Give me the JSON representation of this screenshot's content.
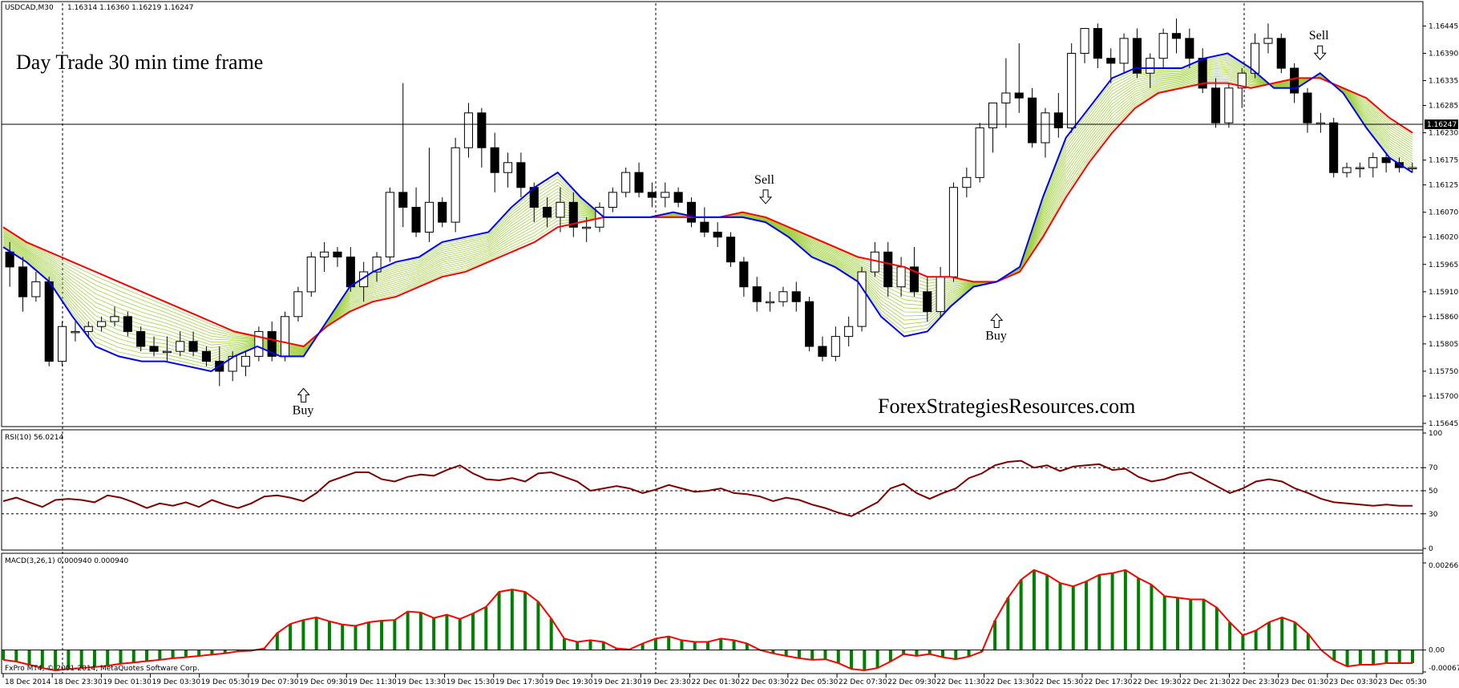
{
  "chart_data": [
    {
      "type": "candlestick",
      "title": "USDCAD,M30",
      "ohlc_readout": "1.16314 1.16360 1.16219 1.16247",
      "annotation_title": "Day Trade 30 min time frame",
      "watermark": "ForexStrategiesResources.com",
      "ylim": [
        1.15645,
        1.16465
      ],
      "yticks": [
        "1.16445",
        "1.16390",
        "1.16335",
        "1.16285",
        "1.16230",
        "1.16175",
        "1.16125",
        "1.16070",
        "1.16020",
        "1.15965",
        "1.15910",
        "1.15860",
        "1.15805",
        "1.15750",
        "1.15700",
        "1.15645"
      ],
      "current_price": "1.16247",
      "signals": [
        {
          "label": "Buy",
          "x_index": 13,
          "direction": "up"
        },
        {
          "label": "Sell",
          "x_index": 33,
          "direction": "down"
        },
        {
          "label": "Buy",
          "x_index": 43,
          "direction": "up"
        },
        {
          "label": "Sell",
          "x_index": 57,
          "direction": "down"
        }
      ],
      "x_tick_labels": [
        "18 Dec 2014",
        "18 Dec 23:30",
        "19 Dec 01:30",
        "19 Dec 03:30",
        "19 Dec 05:30",
        "19 Dec 07:30",
        "19 Dec 09:30",
        "19 Dec 11:30",
        "19 Dec 13:30",
        "19 Dec 15:30",
        "19 Dec 17:30",
        "19 Dec 19:30",
        "19 Dec 21:30",
        "19 Dec 23:30",
        "22 Dec 01:30",
        "22 Dec 03:30",
        "22 Dec 05:30",
        "22 Dec 07:30",
        "22 Dec 09:30",
        "22 Dec 11:30",
        "22 Dec 13:30",
        "22 Dec 15:30",
        "22 Dec 17:30",
        "22 Dec 19:30",
        "22 Dec 21:30",
        "22 Dec 23:30",
        "23 Dec 01:30",
        "23 Dec 03:30",
        "23 Dec 05:30"
      ],
      "fast_ema": [
        1.16,
        1.1597,
        1.1593,
        1.1586,
        1.158,
        1.1578,
        1.1577,
        1.1577,
        1.1576,
        1.1575,
        1.1578,
        1.158,
        1.1578,
        1.1578,
        1.1585,
        1.1592,
        1.1595,
        1.1597,
        1.1598,
        1.1601,
        1.1602,
        1.1603,
        1.1608,
        1.1612,
        1.1615,
        1.161,
        1.1606,
        1.1606,
        1.1606,
        1.1607,
        1.1606,
        1.1606,
        1.1606,
        1.1605,
        1.1602,
        1.1598,
        1.1596,
        1.1593,
        1.1586,
        1.1582,
        1.1583,
        1.1588,
        1.1592,
        1.1593,
        1.1596,
        1.161,
        1.1622,
        1.1628,
        1.1634,
        1.1636,
        1.1636,
        1.1636,
        1.1638,
        1.1639,
        1.1636,
        1.1632,
        1.1632,
        1.1635,
        1.1631,
        1.1624,
        1.1618,
        1.1615
      ],
      "slow_ema": [
        1.1604,
        1.1601,
        1.1599,
        1.1597,
        1.1595,
        1.1593,
        1.1591,
        1.1589,
        1.1587,
        1.1585,
        1.1583,
        1.1582,
        1.1581,
        1.158,
        1.1584,
        1.1587,
        1.1589,
        1.159,
        1.1592,
        1.1594,
        1.1595,
        1.1597,
        1.1599,
        1.1601,
        1.1604,
        1.1605,
        1.1606,
        1.1606,
        1.1606,
        1.1606,
        1.1606,
        1.1606,
        1.1607,
        1.1606,
        1.1604,
        1.1602,
        1.16,
        1.1598,
        1.1597,
        1.1596,
        1.1594,
        1.1594,
        1.1593,
        1.1593,
        1.1595,
        1.1602,
        1.161,
        1.1617,
        1.1623,
        1.1628,
        1.1631,
        1.1632,
        1.1633,
        1.1633,
        1.1632,
        1.1633,
        1.1634,
        1.1634,
        1.1632,
        1.163,
        1.1626,
        1.1623
      ],
      "candles": [
        [
          1.1599,
          1.1601,
          1.1592,
          1.1596
        ],
        [
          1.1596,
          1.1598,
          1.1587,
          1.159
        ],
        [
          1.159,
          1.1595,
          1.1589,
          1.1593
        ],
        [
          1.1593,
          1.1594,
          1.1576,
          1.1577
        ],
        [
          1.1577,
          1.1585,
          1.1576,
          1.1584
        ],
        [
          1.1583,
          1.1585,
          1.1581,
          1.1583
        ],
        [
          1.1583,
          1.1585,
          1.1582,
          1.1584
        ],
        [
          1.1584,
          1.1586,
          1.1583,
          1.1585
        ],
        [
          1.1585,
          1.1588,
          1.1584,
          1.1586
        ],
        [
          1.1586,
          1.1587,
          1.1582,
          1.1583
        ],
        [
          1.1583,
          1.1584,
          1.1579,
          1.158
        ],
        [
          1.158,
          1.1582,
          1.1578,
          1.1579
        ],
        [
          1.1579,
          1.1582,
          1.1577,
          1.1579
        ],
        [
          1.1579,
          1.1583,
          1.1578,
          1.1581
        ],
        [
          1.1581,
          1.1583,
          1.1578,
          1.1579
        ],
        [
          1.1579,
          1.158,
          1.1576,
          1.1577
        ],
        [
          1.1577,
          1.158,
          1.1572,
          1.1575
        ],
        [
          1.1575,
          1.1579,
          1.1573,
          1.1578
        ],
        [
          1.1576,
          1.1579,
          1.1574,
          1.1578
        ],
        [
          1.1578,
          1.1584,
          1.1577,
          1.1583
        ],
        [
          1.1583,
          1.1585,
          1.1577,
          1.1578
        ],
        [
          1.1578,
          1.1587,
          1.1577,
          1.1586
        ],
        [
          1.1586,
          1.1592,
          1.1585,
          1.1591
        ],
        [
          1.1591,
          1.1599,
          1.159,
          1.1598
        ],
        [
          1.1598,
          1.1601,
          1.1595,
          1.1599
        ],
        [
          1.1599,
          1.16,
          1.1596,
          1.1598
        ],
        [
          1.1598,
          1.16,
          1.1591,
          1.1592
        ],
        [
          1.1592,
          1.1597,
          1.1589,
          1.1595
        ],
        [
          1.1595,
          1.1599,
          1.1593,
          1.1598
        ],
        [
          1.1598,
          1.1612,
          1.1597,
          1.1611
        ],
        [
          1.1611,
          1.1633,
          1.1604,
          1.1608
        ],
        [
          1.1608,
          1.1612,
          1.1602,
          1.1603
        ],
        [
          1.1603,
          1.162,
          1.1601,
          1.1609
        ],
        [
          1.1609,
          1.161,
          1.1604,
          1.1605
        ],
        [
          1.1605,
          1.1622,
          1.1603,
          1.162
        ],
        [
          1.162,
          1.1629,
          1.1618,
          1.1627
        ],
        [
          1.1627,
          1.1628,
          1.1616,
          1.162
        ],
        [
          1.162,
          1.1623,
          1.1611,
          1.1615
        ],
        [
          1.1615,
          1.1619,
          1.1612,
          1.1617
        ],
        [
          1.1617,
          1.1619,
          1.161,
          1.1612
        ],
        [
          1.1612,
          1.1613,
          1.1605,
          1.1608
        ],
        [
          1.1608,
          1.161,
          1.1604,
          1.1606
        ],
        [
          1.1606,
          1.1612,
          1.1603,
          1.1609
        ],
        [
          1.1609,
          1.1611,
          1.1602,
          1.1604
        ],
        [
          1.1604,
          1.1606,
          1.1601,
          1.1604
        ],
        [
          1.1604,
          1.1609,
          1.1603,
          1.1608
        ],
        [
          1.1608,
          1.1612,
          1.1607,
          1.1611
        ],
        [
          1.1611,
          1.1616,
          1.161,
          1.1615
        ],
        [
          1.1615,
          1.1617,
          1.161,
          1.1611
        ],
        [
          1.1611,
          1.1613,
          1.1608,
          1.161
        ],
        [
          1.161,
          1.1613,
          1.1608,
          1.1611
        ],
        [
          1.1611,
          1.1612,
          1.1608,
          1.1609
        ],
        [
          1.1609,
          1.161,
          1.1604,
          1.1605
        ],
        [
          1.1605,
          1.1608,
          1.1602,
          1.1603
        ],
        [
          1.1603,
          1.1605,
          1.16,
          1.1602
        ],
        [
          1.1602,
          1.1603,
          1.1596,
          1.1597
        ],
        [
          1.1597,
          1.1598,
          1.159,
          1.1592
        ],
        [
          1.1592,
          1.1594,
          1.1587,
          1.1589
        ],
        [
          1.1589,
          1.1591,
          1.1587,
          1.1589
        ],
        [
          1.1589,
          1.1592,
          1.1588,
          1.1591
        ],
        [
          1.1591,
          1.1593,
          1.1587,
          1.1589
        ],
        [
          1.1589,
          1.159,
          1.1579,
          1.158
        ],
        [
          1.158,
          1.1582,
          1.1577,
          1.1578
        ],
        [
          1.1578,
          1.1584,
          1.1577,
          1.1582
        ],
        [
          1.1582,
          1.1586,
          1.158,
          1.1584
        ],
        [
          1.1584,
          1.1596,
          1.1583,
          1.1595
        ],
        [
          1.1595,
          1.1601,
          1.1594,
          1.1599
        ],
        [
          1.1599,
          1.1601,
          1.159,
          1.1592
        ],
        [
          1.1592,
          1.1598,
          1.159,
          1.1596
        ],
        [
          1.1596,
          1.16,
          1.159,
          1.1591
        ],
        [
          1.1591,
          1.1594,
          1.1585,
          1.1587
        ],
        [
          1.1587,
          1.1596,
          1.1586,
          1.1594
        ],
        [
          1.1594,
          1.1613,
          1.1593,
          1.1612
        ],
        [
          1.1612,
          1.1616,
          1.161,
          1.1614
        ],
        [
          1.1614,
          1.1625,
          1.1613,
          1.1624
        ],
        [
          1.1624,
          1.1629,
          1.1619,
          1.1629
        ],
        [
          1.1629,
          1.1638,
          1.1624,
          1.1631
        ],
        [
          1.1631,
          1.1641,
          1.1627,
          1.163
        ],
        [
          1.163,
          1.1632,
          1.162,
          1.1621
        ],
        [
          1.1621,
          1.1628,
          1.1618,
          1.1627
        ],
        [
          1.1627,
          1.1631,
          1.1622,
          1.1624
        ],
        [
          1.1624,
          1.1641,
          1.1623,
          1.1639
        ],
        [
          1.1639,
          1.1644,
          1.1637,
          1.1644
        ],
        [
          1.1644,
          1.1645,
          1.1636,
          1.1638
        ],
        [
          1.1638,
          1.164,
          1.1633,
          1.1637
        ],
        [
          1.1637,
          1.1643,
          1.1635,
          1.1642
        ],
        [
          1.1642,
          1.1644,
          1.1634,
          1.1635
        ],
        [
          1.1635,
          1.1639,
          1.1632,
          1.1638
        ],
        [
          1.1638,
          1.1644,
          1.1636,
          1.1643
        ],
        [
          1.1643,
          1.1646,
          1.1639,
          1.1642
        ],
        [
          1.1642,
          1.1644,
          1.1636,
          1.1638
        ],
        [
          1.1638,
          1.164,
          1.1631,
          1.1632
        ],
        [
          1.1632,
          1.1634,
          1.1624,
          1.1625
        ],
        [
          1.1625,
          1.1633,
          1.1624,
          1.1632
        ],
        [
          1.1632,
          1.1636,
          1.1628,
          1.1635
        ],
        [
          1.1635,
          1.1643,
          1.1634,
          1.1641
        ],
        [
          1.1641,
          1.1645,
          1.1639,
          1.1642
        ],
        [
          1.1642,
          1.1643,
          1.1635,
          1.1636
        ],
        [
          1.1636,
          1.1637,
          1.1629,
          1.1631
        ],
        [
          1.1631,
          1.1632,
          1.1623,
          1.1625
        ],
        [
          1.1625,
          1.1627,
          1.1623,
          1.1625
        ],
        [
          1.1625,
          1.1626,
          1.1614,
          1.1615
        ],
        [
          1.1615,
          1.1617,
          1.1614,
          1.1616
        ],
        [
          1.1616,
          1.1617,
          1.1614,
          1.1616
        ],
        [
          1.1616,
          1.1619,
          1.1614,
          1.1618
        ],
        [
          1.1618,
          1.1619,
          1.1615,
          1.1617
        ],
        [
          1.1617,
          1.1618,
          1.1615,
          1.1616
        ],
        [
          1.1616,
          1.1617,
          1.1615,
          1.1616
        ]
      ]
    },
    {
      "type": "line",
      "title": "RSI(10) 56.0214",
      "ylim": [
        0,
        100
      ],
      "levels": [
        30,
        50,
        70
      ],
      "yticks": [
        "100",
        "70",
        "50",
        "30",
        "0"
      ],
      "values": [
        41,
        44,
        40,
        36,
        42,
        43,
        42,
        40,
        46,
        44,
        40,
        35,
        39,
        37,
        40,
        36,
        42,
        38,
        35,
        39,
        45,
        46,
        44,
        41,
        48,
        58,
        62,
        66,
        66,
        60,
        58,
        62,
        64,
        63,
        68,
        72,
        65,
        60,
        59,
        61,
        58,
        65,
        66,
        62,
        58,
        50,
        52,
        54,
        52,
        48,
        51,
        55,
        52,
        49,
        50,
        52,
        48,
        47,
        45,
        41,
        44,
        42,
        38,
        35,
        31,
        28,
        34,
        40,
        52,
        56,
        48,
        43,
        48,
        52,
        61,
        65,
        72,
        75,
        76,
        70,
        72,
        67,
        71,
        72,
        73,
        68,
        69,
        62,
        58,
        60,
        64,
        66,
        60,
        54,
        48,
        52,
        58,
        60,
        58,
        52,
        48,
        43,
        40,
        39,
        38,
        37,
        38,
        37,
        37
      ]
    },
    {
      "type": "bar",
      "title": "MACD(3,26,1) 0.000940 0.000940",
      "ylim": [
        -0.00067,
        0.002665
      ],
      "yticks": [
        "0.002665",
        "0.00",
        "-0.00067"
      ],
      "values": [
        -0.0003,
        -0.00035,
        -0.00045,
        -0.00055,
        -0.00062,
        -0.00058,
        -0.00055,
        -0.00052,
        -0.00048,
        -0.00042,
        -0.00038,
        -0.00034,
        -0.0003,
        -0.00025,
        -0.00022,
        -0.00018,
        -0.00014,
        -0.0001,
        -4e-05,
        -2e-05,
        5e-05,
        0.00052,
        0.0008,
        0.00092,
        0.001,
        0.00088,
        0.00078,
        0.00074,
        0.00085,
        0.0009,
        0.00092,
        0.00118,
        0.00115,
        0.00098,
        0.00108,
        0.00095,
        0.00112,
        0.00132,
        0.00178,
        0.00185,
        0.00178,
        0.00148,
        0.00096,
        0.00035,
        0.00025,
        0.0003,
        0.00025,
        5e-05,
        2e-05,
        0.0002,
        0.00035,
        0.00042,
        0.0003,
        0.00025,
        0.00025,
        0.00035,
        0.0003,
        0.0002,
        0.0,
        -0.0001,
        -0.00018,
        -0.00025,
        -0.0003,
        -0.00028,
        -0.0004,
        -0.00058,
        -0.00062,
        -0.00055,
        -0.00035,
        -0.00012,
        -0.00018,
        -0.00012,
        -0.00022,
        -0.00028,
        -0.0002,
        -5e-05,
        0.0009,
        0.0016,
        0.00215,
        0.00245,
        0.0023,
        0.00205,
        0.00195,
        0.0021,
        0.0023,
        0.00235,
        0.00245,
        0.0022,
        0.002,
        0.00165,
        0.0016,
        0.00155,
        0.00155,
        0.0013,
        0.00085,
        0.00045,
        0.0006,
        0.00085,
        0.001,
        0.00085,
        0.0005,
        0.0,
        -0.00032,
        -0.0005,
        -0.00045,
        -0.00045,
        -0.0004,
        -0.0004,
        -0.0004
      ],
      "current_label": "0.00"
    }
  ],
  "footer": {
    "copyright": "FxPro MT4, © 2001-2014, MetaQuotes Software Corp."
  },
  "colors": {
    "bull_candle": "#ffffff",
    "bear_candle": "#000000",
    "fast_ema": "#0000ff",
    "slow_ema": "#ff0000",
    "ribbon": "#9acd32",
    "rsi": "#800000",
    "macd_bars": "#008000",
    "macd_signal": "#ff0000"
  }
}
